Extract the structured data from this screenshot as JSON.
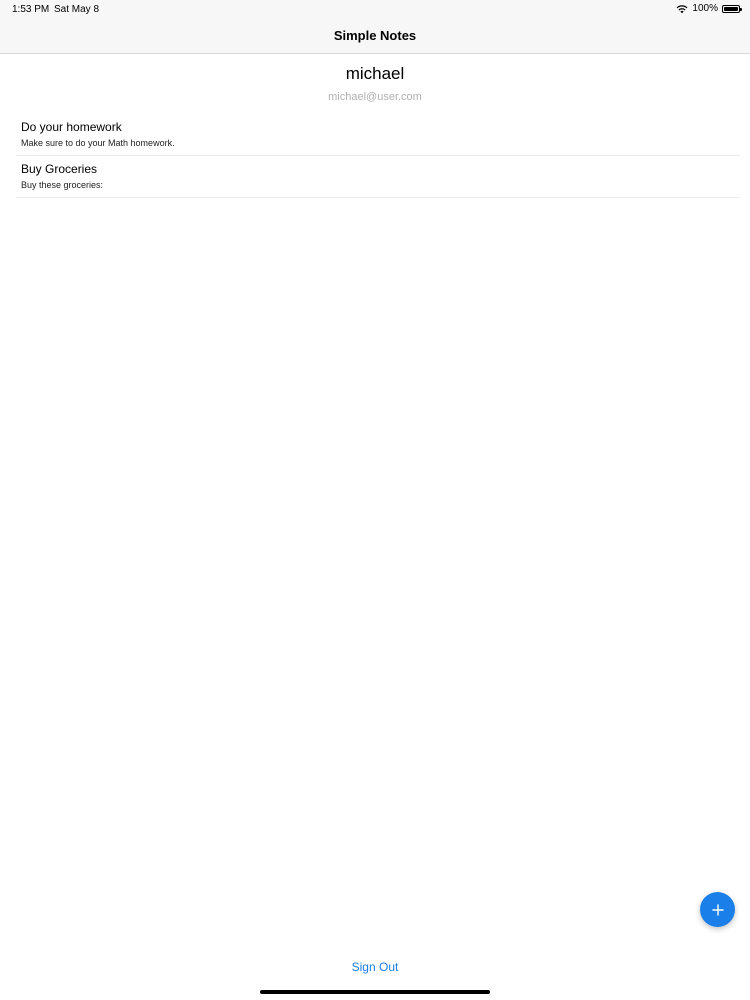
{
  "status_bar": {
    "time": "1:53 PM",
    "date": "Sat May 8",
    "battery": "100%"
  },
  "nav": {
    "title": "Simple Notes"
  },
  "profile": {
    "name": "michael",
    "email": "michael@user.com"
  },
  "notes": [
    {
      "title": "Do your homework",
      "subtitle": "Make sure to do your Math homework."
    },
    {
      "title": "Buy Groceries",
      "subtitle": "Buy these groceries:"
    }
  ],
  "actions": {
    "sign_out": "Sign Out",
    "add_icon": "plus-icon"
  },
  "colors": {
    "accent": "#1a7fe8",
    "secondary_text": "#b0b0b0"
  }
}
